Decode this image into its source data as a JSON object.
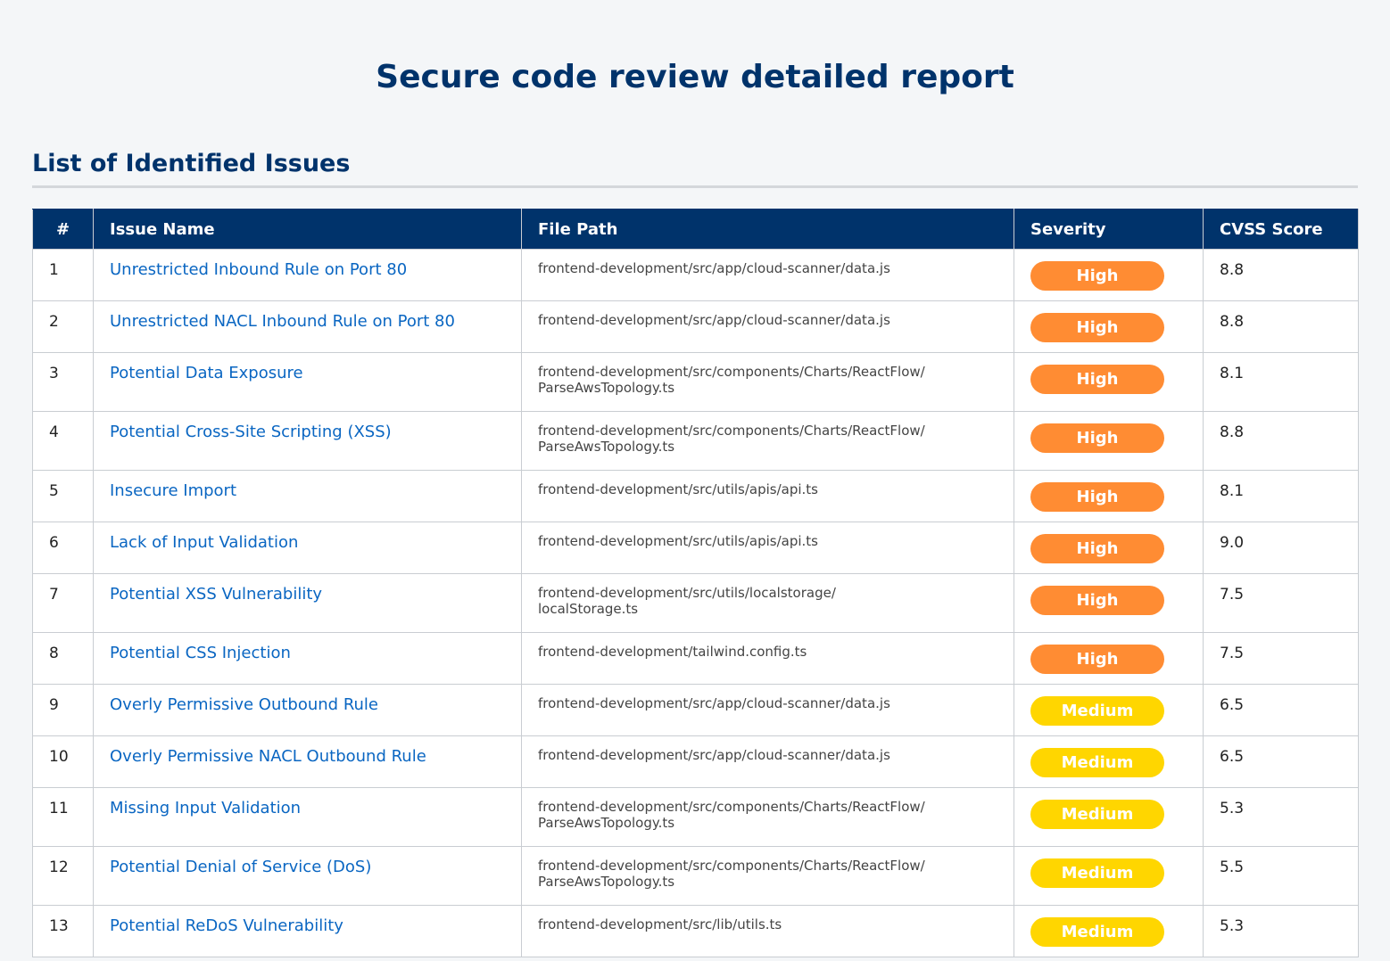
{
  "report": {
    "title": "Secure code review detailed report",
    "section_title": "List of Identified Issues"
  },
  "table": {
    "headers": [
      "#",
      "Issue Name",
      "File Path",
      "Severity",
      "CVSS Score"
    ],
    "rows": [
      {
        "num": "1",
        "name": "Unrestricted Inbound Rule on Port 80",
        "path_lines": [
          "frontend-development/src/app/cloud-scanner/data.js"
        ],
        "severity": "High",
        "score": "8.8"
      },
      {
        "num": "2",
        "name": "Unrestricted NACL Inbound Rule on Port 80",
        "path_lines": [
          "frontend-development/src/app/cloud-scanner/data.js"
        ],
        "severity": "High",
        "score": "8.8"
      },
      {
        "num": "3",
        "name": "Potential Data Exposure",
        "path_lines": [
          "frontend-development/src/components/Charts/ReactFlow/",
          "ParseAwsTopology.ts"
        ],
        "severity": "High",
        "score": "8.1"
      },
      {
        "num": "4",
        "name": "Potential Cross-Site Scripting (XSS)",
        "path_lines": [
          "frontend-development/src/components/Charts/ReactFlow/",
          "ParseAwsTopology.ts"
        ],
        "severity": "High",
        "score": "8.8"
      },
      {
        "num": "5",
        "name": "Insecure Import",
        "path_lines": [
          "frontend-development/src/utils/apis/api.ts"
        ],
        "severity": "High",
        "score": "8.1"
      },
      {
        "num": "6",
        "name": "Lack of Input Validation",
        "path_lines": [
          "frontend-development/src/utils/apis/api.ts"
        ],
        "severity": "High",
        "score": "9.0"
      },
      {
        "num": "7",
        "name": "Potential XSS Vulnerability",
        "path_lines": [
          "frontend-development/src/utils/localstorage/",
          "localStorage.ts"
        ],
        "severity": "High",
        "score": "7.5"
      },
      {
        "num": "8",
        "name": "Potential CSS Injection",
        "path_lines": [
          "frontend-development/tailwind.config.ts"
        ],
        "severity": "High",
        "score": "7.5"
      },
      {
        "num": "9",
        "name": "Overly Permissive Outbound Rule",
        "path_lines": [
          "frontend-development/src/app/cloud-scanner/data.js"
        ],
        "severity": "Medium",
        "score": "6.5"
      },
      {
        "num": "10",
        "name": "Overly Permissive NACL Outbound Rule",
        "path_lines": [
          "frontend-development/src/app/cloud-scanner/data.js"
        ],
        "severity": "Medium",
        "score": "6.5"
      },
      {
        "num": "11",
        "name": "Missing Input Validation",
        "path_lines": [
          "frontend-development/src/components/Charts/ReactFlow/",
          "ParseAwsTopology.ts"
        ],
        "severity": "Medium",
        "score": "5.3"
      },
      {
        "num": "12",
        "name": "Potential Denial of Service (DoS)",
        "path_lines": [
          "frontend-development/src/components/Charts/ReactFlow/",
          "ParseAwsTopology.ts"
        ],
        "severity": "Medium",
        "score": "5.5"
      },
      {
        "num": "13",
        "name": "Potential ReDoS Vulnerability",
        "path_lines": [
          "frontend-development/src/lib/utils.ts"
        ],
        "severity": "Medium",
        "score": "5.3"
      }
    ]
  },
  "colors": {
    "title": "#00336b",
    "header_bg": "#00336b",
    "link": "#0a66c2",
    "high": "#ff8c33",
    "medium": "#ffd600"
  }
}
